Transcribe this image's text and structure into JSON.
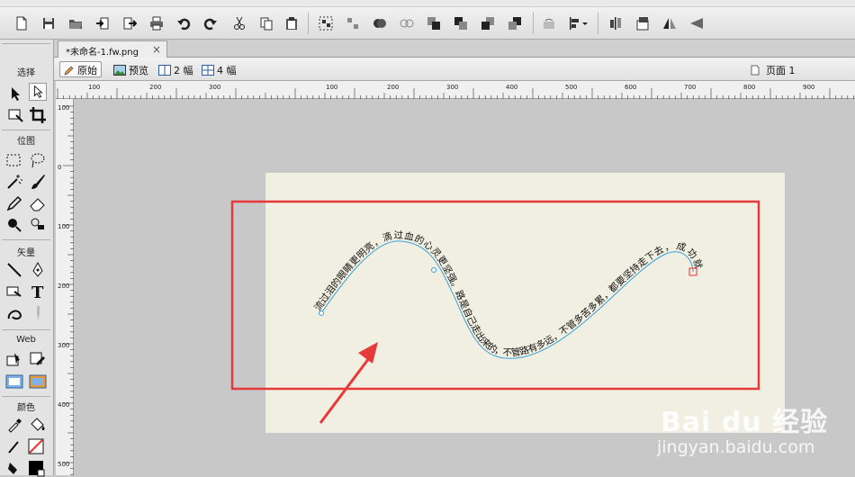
{
  "toolbar": {
    "icons": [
      "new-file-icon",
      "save-icon",
      "open-folder-icon",
      "import-icon",
      "export-icon",
      "print-icon",
      "undo-icon",
      "redo-icon",
      "cut-icon",
      "copy-icon",
      "paste-icon",
      "group-icon",
      "ungroup-icon",
      "join-icon",
      "split-icon",
      "bring-to-front-icon",
      "bring-forward-icon",
      "send-backward-icon",
      "send-to-back-icon",
      "align-icon",
      "rotate-icon",
      "flip-icon",
      "distort-icon"
    ]
  },
  "tools_panel": {
    "header": "选择",
    "section_bitmap": "位图",
    "section_vector": "矢量",
    "section_web": "Web",
    "section_colors": "颜色"
  },
  "document": {
    "tab_title": "*未命名-1.fw.png",
    "close_glyph": "×"
  },
  "view": {
    "original": "原始",
    "preview": "预览",
    "two_up": "2 幅",
    "four_up": "4 幅",
    "page": "页面 1"
  },
  "ruler": {
    "h_labels": [
      "100",
      "200",
      "300",
      "100",
      "200",
      "300",
      "400",
      "500",
      "600",
      "700",
      "800",
      "900"
    ],
    "v_labels": [
      "100",
      "0",
      "100",
      "200",
      "300",
      "400",
      "500"
    ]
  },
  "canvas": {
    "path_text": "流过泪的眼睛更明亮，滴过血的心灵更坚强。路是自己走出来的，不管路有多远，不管多苦多累，都要坚持走下去，成功就在不远的地方等着你。"
  },
  "colors": {
    "canvas_bg": "#f0efe1",
    "highlight_box": "#e8393a",
    "path_line": "#3aa0d8"
  },
  "watermark": {
    "brand": "Bai du 经验",
    "sub": "jingyan.baidu.com"
  }
}
